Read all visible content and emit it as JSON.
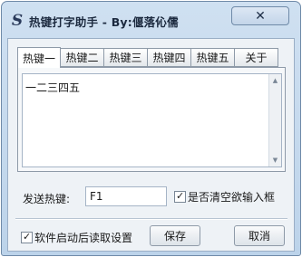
{
  "window": {
    "app_icon_glyph": "S",
    "title": "热键打字助手 - By:偃落伈儒",
    "close_glyph": "✕"
  },
  "tabs": [
    "热键一",
    "热键二",
    "热键三",
    "热键四",
    "热键五",
    "关于"
  ],
  "active_tab": "热键一",
  "textarea": {
    "value": "一二三四五"
  },
  "scroll": {
    "up_glyph": "▲",
    "down_glyph": "▼"
  },
  "hotkey": {
    "label": "发送热键:",
    "value": "F1"
  },
  "clear_input": {
    "label": "是否清空欲输入框",
    "checked": true
  },
  "autoload": {
    "label": "软件启动后读取设置",
    "checked": true
  },
  "check_glyph": "✓",
  "buttons": {
    "save": "保存",
    "cancel": "取消"
  },
  "colors": {
    "title_bar": "#cfe0f1",
    "border": "#6f8aa8",
    "client_bg": "#eef2f6"
  }
}
